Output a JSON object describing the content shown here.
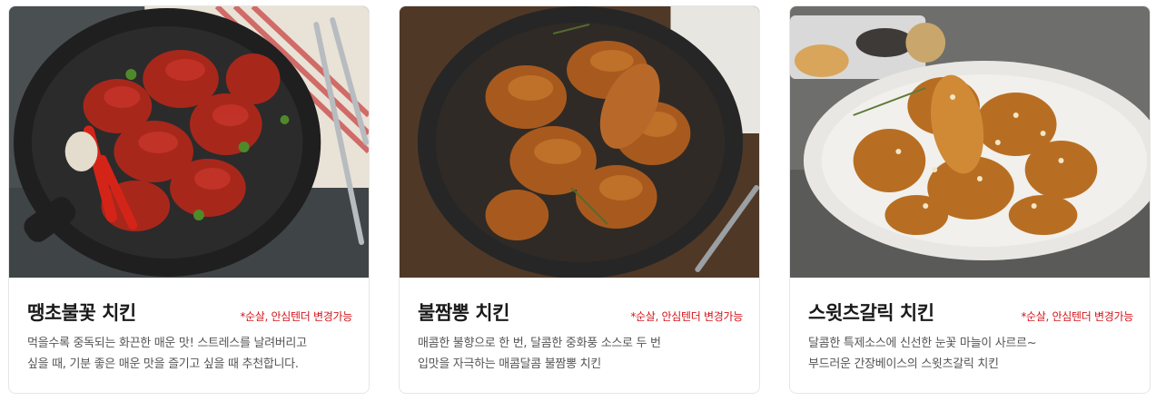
{
  "cards": [
    {
      "title": "땡초불꽃 치킨",
      "note": "*순살, 안심텐더 변경가능",
      "desc_line1": "먹을수록 중독되는 화끈한 매운 맛! 스트레스를 날려버리고",
      "desc_line2": "싶을 때, 기분 좋은 매운 맛을 즐기고 싶을 때 추천합니다."
    },
    {
      "title": "불짬뽕 치킨",
      "note": "*순살, 안심텐더 변경가능",
      "desc_line1": "매콤한 불향으로 한 번, 달콤한 중화풍 소스로 두 번",
      "desc_line2": "입맛을 자극하는 매콤달콤 불짬뽕 치킨"
    },
    {
      "title": "스윗츠갈릭 치킨",
      "note": "*순살, 안심텐더 변경가능",
      "desc_line1": "달콤한 특제소스에 신선한 눈꽃 마늘이 사르르~",
      "desc_line2": "부드러운 간장베이스의 스윗츠갈릭 치킨"
    }
  ],
  "colors": {
    "note": "#d4141a",
    "title": "#1a1a1a",
    "desc": "#555555"
  }
}
